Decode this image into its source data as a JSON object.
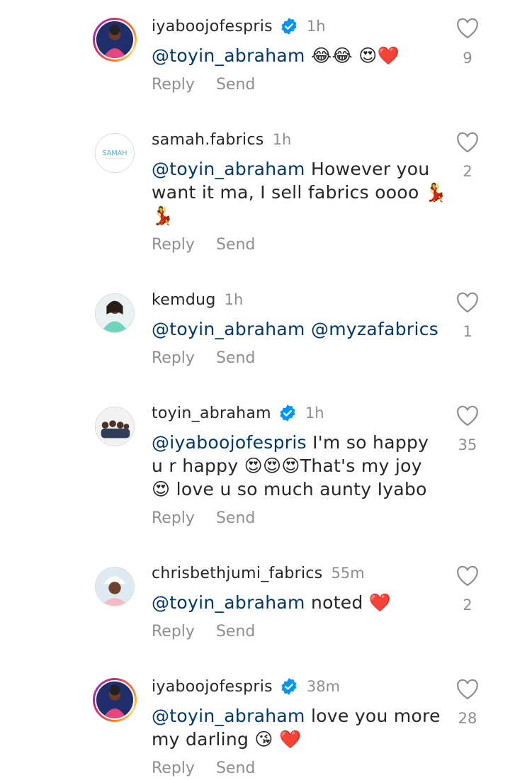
{
  "reply_label": "Reply",
  "send_label": "Send",
  "comments": [
    {
      "username": "iyaboojofespris",
      "verified": true,
      "time": "1h",
      "mention": "@toyin_abraham",
      "text": " 😂😂 😍❤️",
      "likes": "9"
    },
    {
      "username": "samah.fabrics",
      "verified": false,
      "time": "1h",
      "mention": "@toyin_abraham",
      "text": " However you want it ma, I sell fabrics oooo 💃💃",
      "likes": "2",
      "avatar_text": "SAMAH"
    },
    {
      "username": "kemdug",
      "verified": false,
      "time": "1h",
      "mention": "@toyin_abraham",
      "text": " @myzafabrics",
      "likes": "1"
    },
    {
      "username": "toyin_abraham",
      "verified": true,
      "time": "1h",
      "mention": "@iyaboojofespris",
      "text": " I'm so happy u r happy 😍😍😍That's my joy 😍 love u so much aunty Iyabo",
      "likes": "35"
    },
    {
      "username": "chrisbethjumi_fabrics",
      "verified": false,
      "time": "55m",
      "mention": "@toyin_abraham",
      "text": " noted ❤️",
      "likes": "2"
    },
    {
      "username": "iyaboojofespris",
      "verified": true,
      "time": "38m",
      "mention": "@toyin_abraham",
      "text": " love you more my darling 😘 ❤️",
      "likes": "28"
    }
  ]
}
